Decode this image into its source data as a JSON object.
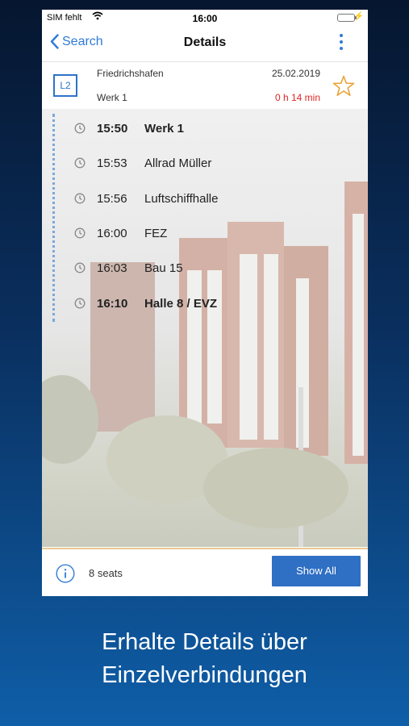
{
  "status_bar": {
    "carrier": "SIM fehlt",
    "time": "16:00"
  },
  "nav": {
    "back_label": "Search",
    "title": "Details"
  },
  "connection": {
    "line": "L2",
    "from": "Friedrichshafen",
    "to": "Werk 1",
    "date": "25.02.2019",
    "duration": "0 h 14 min"
  },
  "stops": [
    {
      "time": "15:50",
      "name": "Werk 1"
    },
    {
      "time": "15:53",
      "name": "Allrad Müller"
    },
    {
      "time": "15:56",
      "name": "Luftschiffhalle"
    },
    {
      "time": "16:00",
      "name": "FEZ"
    },
    {
      "time": "16:03",
      "name": "Bau 15"
    },
    {
      "time": "16:10",
      "name": "Halle 8 / EVZ"
    }
  ],
  "footer": {
    "seats": "8 seats",
    "show_all_label": "Show All"
  },
  "caption": {
    "line1": "Erhalte Details über",
    "line2": "Einzelverbindungen"
  },
  "colors": {
    "accent": "#2f7bd8",
    "duration_red": "#e02525",
    "button_blue": "#2f6fc4"
  },
  "icons": [
    "wifi-icon",
    "battery-icon",
    "back-chevron-icon",
    "more-icon",
    "star-icon",
    "clock-icon",
    "info-icon"
  ]
}
